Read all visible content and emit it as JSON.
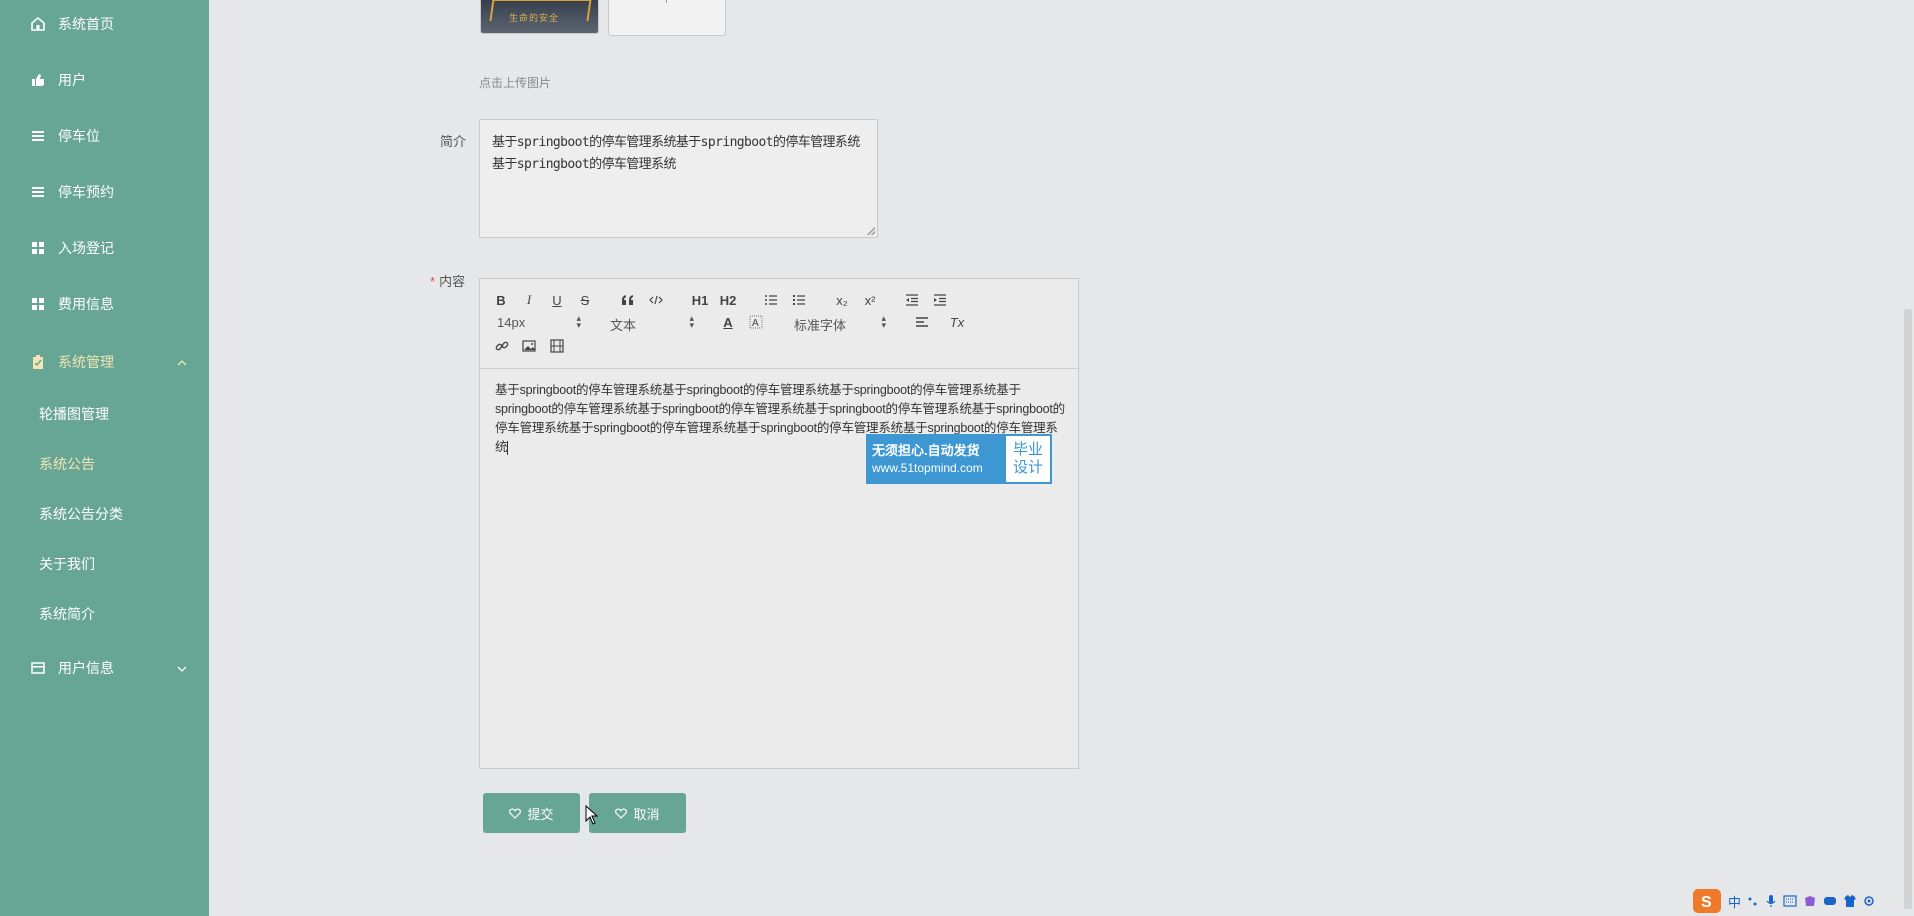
{
  "sidebar": {
    "items": [
      {
        "label": "系统首页",
        "icon": "home-icon"
      },
      {
        "label": "用户",
        "icon": "user-icon"
      },
      {
        "label": "停车位",
        "icon": "list-icon"
      },
      {
        "label": "停车预约",
        "icon": "list-icon"
      },
      {
        "label": "入场登记",
        "icon": "grid-icon"
      },
      {
        "label": "费用信息",
        "icon": "grid-icon"
      },
      {
        "label": "系统管理",
        "icon": "clipboard-icon",
        "expanded": true
      },
      {
        "label": "用户信息",
        "icon": "card-icon",
        "expanded": false
      }
    ],
    "sub_items": [
      {
        "label": "轮播图管理"
      },
      {
        "label": "系统公告",
        "active": true
      },
      {
        "label": "系统公告分类"
      },
      {
        "label": "关于我们"
      },
      {
        "label": "系统简介"
      }
    ],
    "active_color": "#f3e6b4",
    "bg_color": "#67a595"
  },
  "form": {
    "upload_hint": "点击上传图片",
    "image_text": "生命的安全",
    "intro_label": "简介",
    "intro_value": "基于springboot的停车管理系统基于springboot的停车管理系统基于springboot的停车管理系统",
    "content_label": "内容",
    "content_required_mark": "*",
    "content_value": "基于springboot的停车管理系统基于springboot的停车管理系统基于springboot的停车管理系统基于springboot的停车管理系统基于springboot的停车管理系统基于springboot的停车管理系统基于springboot的停车管理系统基于springboot的停车管理系统基于springboot的停车管理系统基于springboot的停车管理系统"
  },
  "editor": {
    "toolbar": {
      "bold": "B",
      "italic": "I",
      "underline": "U",
      "strike": "S",
      "h1": "H1",
      "h2": "H2",
      "sub": "x₂",
      "sup": "x²",
      "size": "14px",
      "header_select": "文本",
      "font_select": "标准字体",
      "color": "A",
      "clean": "Tx"
    }
  },
  "watermark": {
    "line1": "无须担心.自动发货",
    "line2": "www.51topmind.com",
    "right1": "毕业",
    "right2": "设计"
  },
  "buttons": {
    "submit": "提交",
    "cancel": "取消"
  },
  "tray": {
    "ime": "中"
  }
}
